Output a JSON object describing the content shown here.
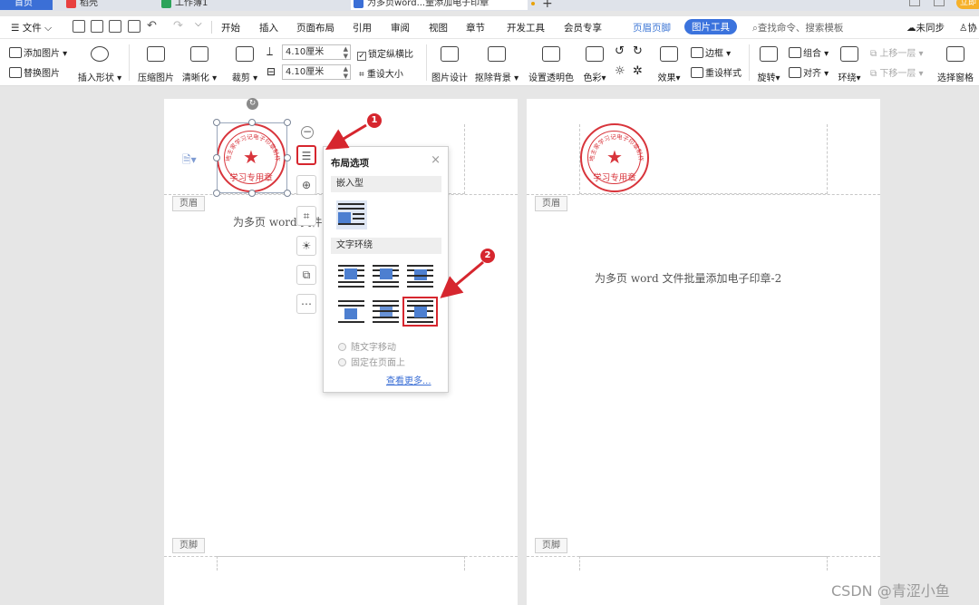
{
  "tabs": [
    {
      "label": "首页"
    },
    {
      "label": "稻壳"
    },
    {
      "label": "工作簿1"
    },
    {
      "label": "为多页word...量添加电子印章"
    }
  ],
  "menu": {
    "file": "文件",
    "items": [
      "开始",
      "插入",
      "页面布局",
      "引用",
      "审阅",
      "视图",
      "章节",
      "开发工具",
      "会员专享"
    ],
    "header_footer": "页眉页脚",
    "picture_tools": "图片工具",
    "search": "查找命令、搜索模板",
    "sync": "未同步",
    "share": "协"
  },
  "toolbar": {
    "add_picture": "添加图片",
    "replace_picture": "替换图片",
    "insert_shape": "插入形状",
    "compress": "压缩图片",
    "sharpen": "清晰化",
    "crop": "裁剪",
    "height": "4.10厘米",
    "width": "4.10厘米",
    "lock_ratio": "锁定纵横比",
    "reset_size": "重设大小",
    "picture_design": "图片设计",
    "remove_bg": "抠除背景",
    "set_transparent": "设置透明色",
    "color": "色彩",
    "effects": "效果",
    "border": "边框",
    "reset_style": "重设样式",
    "rotate": "旋转",
    "group": "组合",
    "align": "对齐",
    "wrap": "环绕",
    "bring_forward": "上移一层",
    "send_backward": "下移一层",
    "selection_pane": "选择窗格"
  },
  "pages": {
    "header_label": "页眉",
    "footer_label": "页脚",
    "left_text": "为多页 word 文件",
    "right_text": "为多页 word 文件批量添加电子印章-2"
  },
  "stamp": {
    "arc_text": "地主家学习记电子印章制作",
    "center_text": "学习专用章"
  },
  "popup": {
    "title": "布局选项",
    "inline_section": "嵌入型",
    "wrap_section": "文字环绕",
    "radio_move": "随文字移动",
    "radio_fixed": "固定在页面上",
    "more": "查看更多..."
  },
  "callouts": [
    "1",
    "2"
  ],
  "watermark": "CSDN @青涩小鱼",
  "colors": {
    "accent": "#3b73dd",
    "stamp_red": "#d8343b",
    "highlight_red": "#d6262e"
  }
}
